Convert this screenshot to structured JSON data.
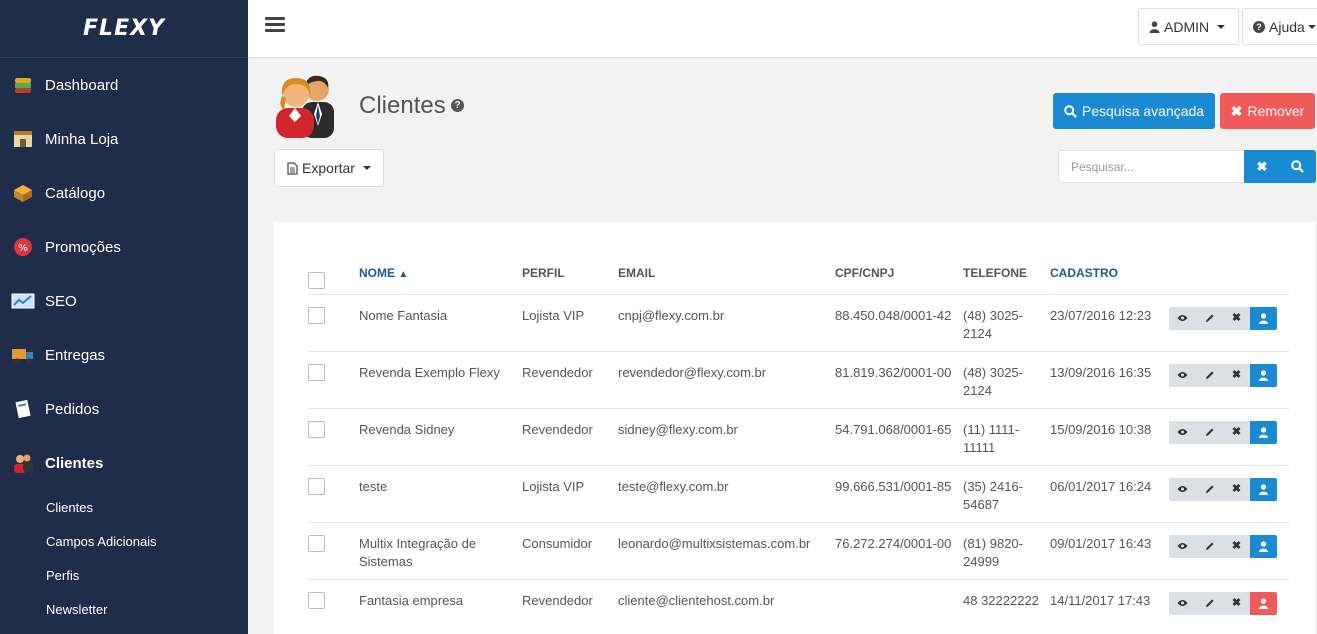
{
  "brand": "FLEXY",
  "sidebar": {
    "items": [
      {
        "label": "Dashboard"
      },
      {
        "label": "Minha Loja"
      },
      {
        "label": "Catálogo"
      },
      {
        "label": "Promoções"
      },
      {
        "label": "SEO"
      },
      {
        "label": "Entregas"
      },
      {
        "label": "Pedidos"
      },
      {
        "label": "Clientes"
      }
    ],
    "subitems": [
      {
        "label": "Clientes"
      },
      {
        "label": "Campos Adicionais"
      },
      {
        "label": "Perfis"
      },
      {
        "label": "Newsletter"
      }
    ]
  },
  "topbar": {
    "user_label": "ADMIN",
    "help_label": "Ajuda"
  },
  "page": {
    "title": "Clientes",
    "advanced_search_label": "Pesquisa avançada",
    "remove_label": "Remover",
    "export_label": "Exportar",
    "search_placeholder": "Pesquisar..."
  },
  "table": {
    "headers": {
      "name": "NOME",
      "profile": "PERFIL",
      "email": "EMAIL",
      "doc": "CPF/CNPJ",
      "phone": "TELEFONE",
      "date": "CADASTRO"
    },
    "rows": [
      {
        "name": "Nome Fantasia",
        "profile": "Lojista VIP",
        "email": "cnpj@flexy.com.br",
        "doc": "88.450.048/0001-42",
        "phone": "(48) 3025-2124",
        "date": "23/07/2016 12:23"
      },
      {
        "name": "Revenda Exemplo Flexy",
        "profile": "Revendedor",
        "email": "revendedor@flexy.com.br",
        "doc": "81.819.362/0001-00",
        "phone": "(48) 3025-2124",
        "date": "13/09/2016 16:35"
      },
      {
        "name": "Revenda Sidney",
        "profile": "Revendedor",
        "email": "sidney@flexy.com.br",
        "doc": "54.791.068/0001-65",
        "phone": "(11) 1111-11111",
        "date": "15/09/2016 10:38"
      },
      {
        "name": "teste",
        "profile": "Lojista VIP",
        "email": "teste@flexy.com.br",
        "doc": "99.666.531/0001-85",
        "phone": "(35) 2416-54687",
        "date": "06/01/2017 16:24"
      },
      {
        "name": "Multix Integração de Sistemas",
        "profile": "Consumidor",
        "email": "leonardo@multixsistemas.com.br",
        "doc": "76.272.274/0001-00",
        "phone": "(81) 9820-24999",
        "date": "09/01/2017 16:43"
      },
      {
        "name": "Fantasia empresa",
        "profile": "Revendedor",
        "email": "cliente@clientehost.com.br",
        "doc": "",
        "phone": "48 32222222",
        "date": "14/11/2017 17:43"
      }
    ]
  },
  "colors": {
    "sidebar_bg": "#1f2d4a",
    "primary": "#1a8ad3",
    "danger": "#ef5b5b"
  }
}
